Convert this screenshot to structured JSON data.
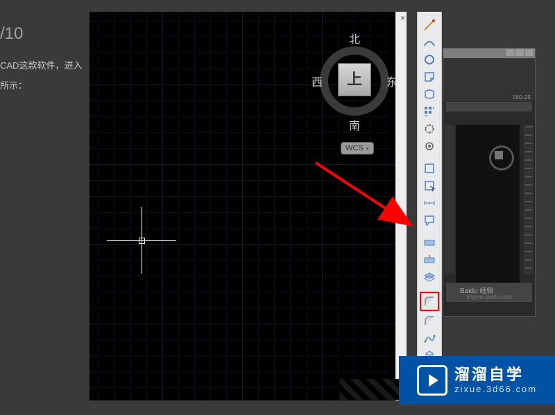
{
  "page": {
    "step": "/10",
    "line1": "CAD这款软件，进入",
    "line2": "所示："
  },
  "viewcube": {
    "north": "北",
    "south": "南",
    "west": "西",
    "east": "东",
    "top": "上",
    "wcs": "WCS"
  },
  "toolbar": {
    "items": [
      {
        "name": "line-tool"
      },
      {
        "name": "curve-tool"
      },
      {
        "name": "circle-tool"
      },
      {
        "name": "section-tool"
      },
      {
        "name": "loop-tool"
      },
      {
        "name": "array-tool"
      },
      {
        "name": "orbit-tool"
      },
      {
        "name": "pan-tool"
      },
      {
        "name": "region-tool"
      },
      {
        "name": "region-select-tool"
      },
      {
        "name": "measure-tool"
      },
      {
        "name": "note-tool"
      },
      {
        "name": "plane-tool"
      },
      {
        "name": "plane-vertical-tool"
      },
      {
        "name": "layer-tool"
      },
      {
        "name": "fillet-tool"
      },
      {
        "name": "chamfer-tool"
      },
      {
        "name": "path-tool"
      },
      {
        "name": "cube-tool"
      },
      {
        "name": "layers-tool"
      },
      {
        "name": "properties-tool"
      }
    ]
  },
  "thumbnail": {
    "iso": "ISO-25",
    "baidu": "Baidu 经验",
    "url": "jingyan.baidu.com"
  },
  "watermark": {
    "title": "溜溜自学",
    "url": "zixue.3d66.com"
  }
}
